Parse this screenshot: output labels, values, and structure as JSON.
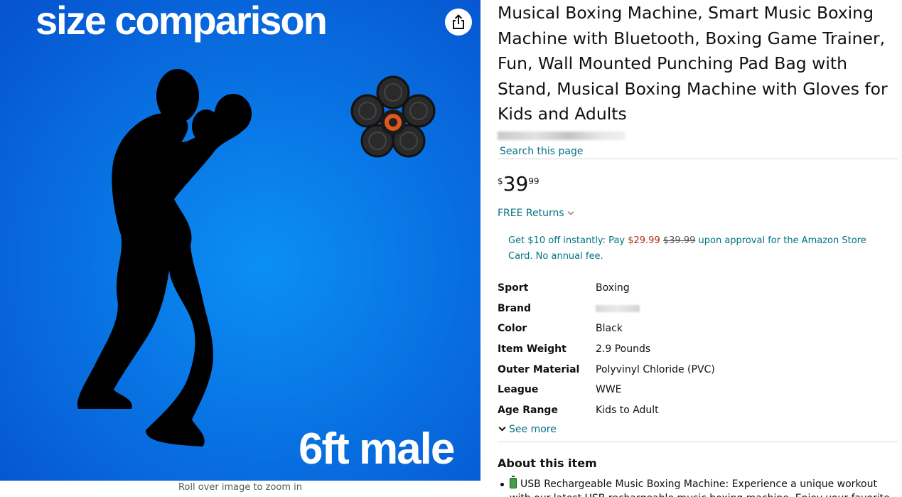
{
  "image": {
    "headline": "size comparison",
    "caption": "6ft male",
    "zoom_hint": "Roll over image to zoom in",
    "background_color": "#0a6fe0"
  },
  "product": {
    "title": "Musical Boxing Machine, Smart Music Boxing Machine with Bluetooth, Boxing Game Trainer, Fun, Wall Mounted Punching Pad Bag with Stand, Musical Boxing Machine with Gloves for Kids and Adults",
    "search_link": "Search this page",
    "price": {
      "symbol": "$",
      "whole": "39",
      "fraction": "99"
    },
    "returns_label": "FREE Returns",
    "promo": {
      "text_before": "Get $10 off instantly: Pay ",
      "sale_price": "$29.99",
      "list_price": "$39.99",
      "text_after": " upon approval for the Amazon Store Card. No annual fee."
    },
    "specs": [
      {
        "key": "Sport",
        "value": "Boxing"
      },
      {
        "key": "Brand",
        "value": ""
      },
      {
        "key": "Color",
        "value": "Black"
      },
      {
        "key": "Item Weight",
        "value": "2.9 Pounds"
      },
      {
        "key": "Outer Material",
        "value": "Polyvinyl Chloride (PVC)"
      },
      {
        "key": "League",
        "value": "WWE"
      },
      {
        "key": "Age Range",
        "value": "Kids to Adult"
      }
    ],
    "see_more": "See more",
    "about_heading": "About this item",
    "bullets": [
      "USB Rechargeable Music Boxing Machine: Experience a unique workout with our latest USB rechargeable music boxing machine. Enjoy your favorite"
    ]
  },
  "colors": {
    "link": "#007185",
    "price_red": "#b12704",
    "text": "#0f1111"
  },
  "icons": {
    "share": "share-icon",
    "returns_chevron": "chevron-down-icon",
    "see_more_chevron": "chevron-down-icon",
    "battery": "battery-icon"
  }
}
